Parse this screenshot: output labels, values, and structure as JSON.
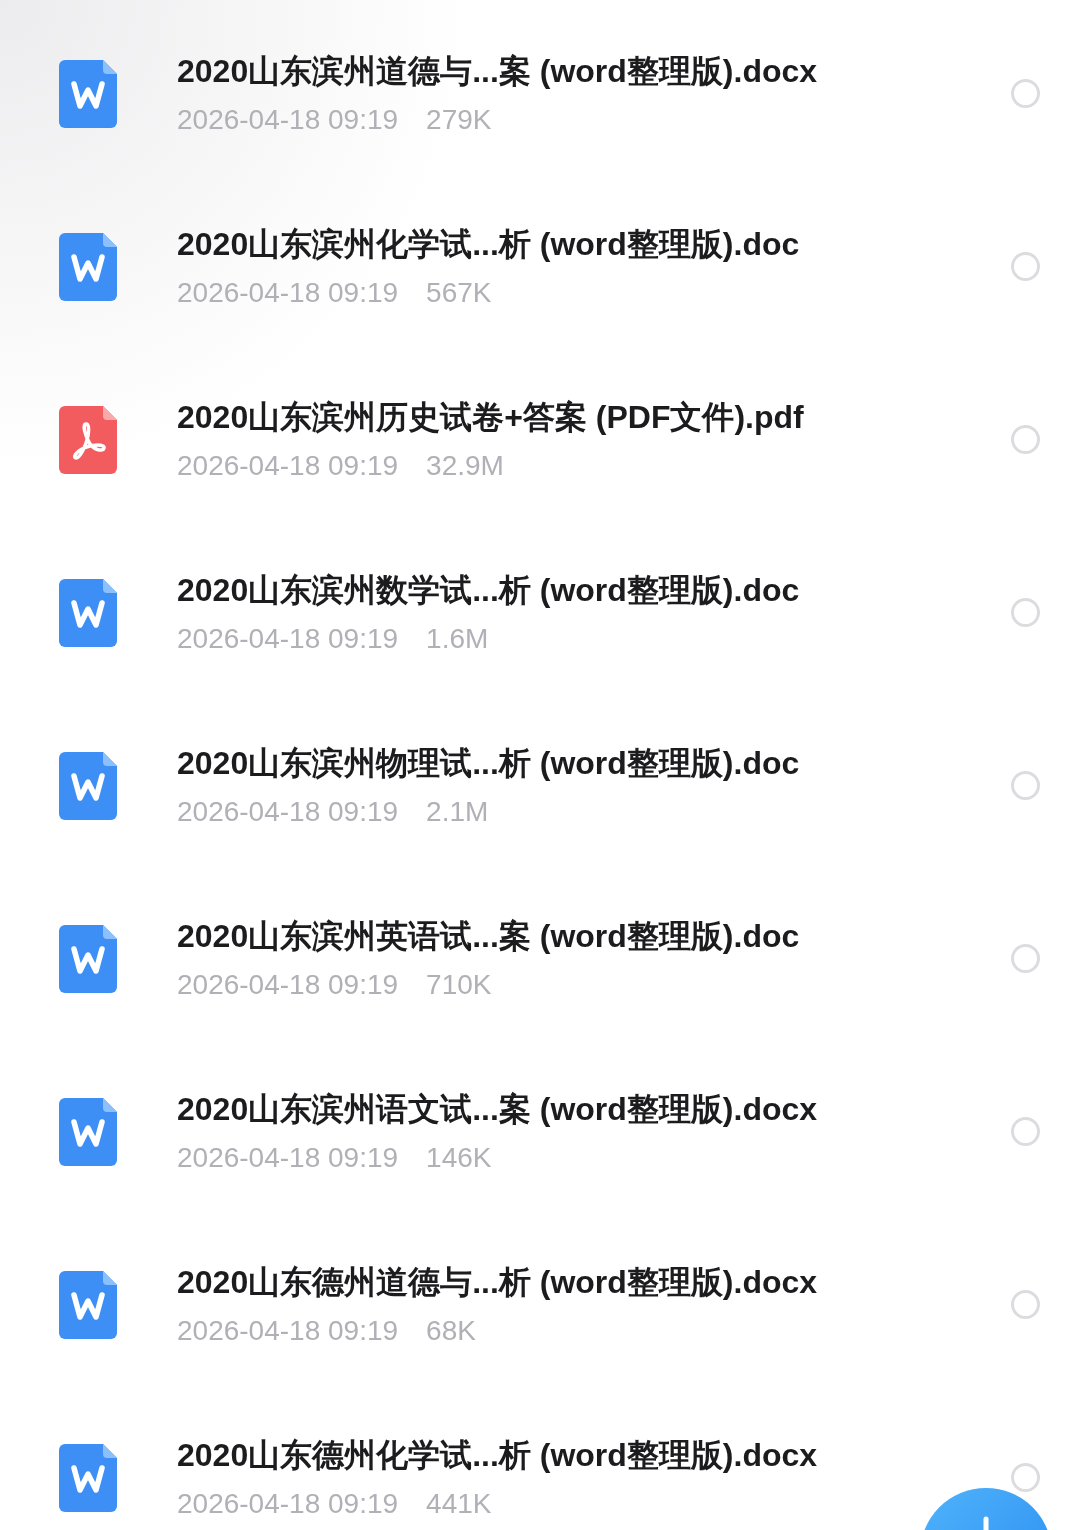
{
  "files": [
    {
      "kind": "word",
      "name": "2020山东滨州道德与...案 (word整理版).docx",
      "date": "2026-04-18 09:19",
      "size": "279K",
      "selected": false
    },
    {
      "kind": "word",
      "name": "2020山东滨州化学试...析 (word整理版).doc",
      "date": "2026-04-18 09:19",
      "size": "567K",
      "selected": false
    },
    {
      "kind": "pdf",
      "name": "2020山东滨州历史试卷+答案 (PDF文件).pdf",
      "date": "2026-04-18 09:19",
      "size": "32.9M",
      "selected": false
    },
    {
      "kind": "word",
      "name": "2020山东滨州数学试...析 (word整理版).doc",
      "date": "2026-04-18 09:19",
      "size": "1.6M",
      "selected": false
    },
    {
      "kind": "word",
      "name": "2020山东滨州物理试...析 (word整理版).doc",
      "date": "2026-04-18 09:19",
      "size": "2.1M",
      "selected": false
    },
    {
      "kind": "word",
      "name": "2020山东滨州英语试...案 (word整理版).doc",
      "date": "2026-04-18 09:19",
      "size": "710K",
      "selected": false
    },
    {
      "kind": "word",
      "name": "2020山东滨州语文试...案 (word整理版).docx",
      "date": "2026-04-18 09:19",
      "size": "146K",
      "selected": false
    },
    {
      "kind": "word",
      "name": "2020山东德州道德与...析 (word整理版).docx",
      "date": "2026-04-18 09:19",
      "size": "68K",
      "selected": false
    },
    {
      "kind": "word",
      "name": "2020山东德州化学试...析 (word整理版).docx",
      "date": "2026-04-18 09:19",
      "size": "441K",
      "selected": false
    }
  ]
}
